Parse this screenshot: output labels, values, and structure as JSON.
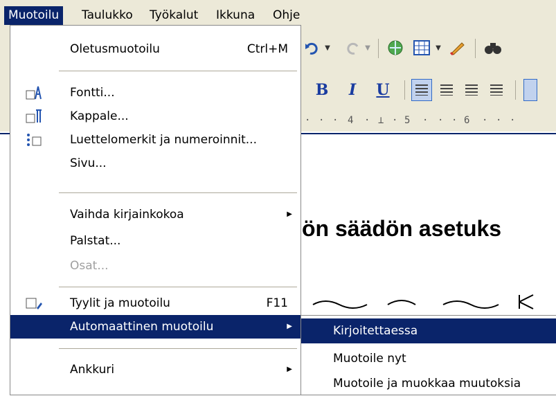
{
  "menubar": {
    "items": [
      {
        "label": "Muotoilu",
        "active": true
      },
      {
        "label": "Taulukko"
      },
      {
        "label": "Työkalut"
      },
      {
        "label": "Ikkuna"
      },
      {
        "label": "Ohje"
      }
    ]
  },
  "toolbar": {
    "bold": "B",
    "italic": "I",
    "underline": "U"
  },
  "ruler": {
    "marks": [
      "4",
      "5",
      "6"
    ]
  },
  "document": {
    "heading": "ön säädön asetuks"
  },
  "format_menu": {
    "items": [
      {
        "label": "Oletusmuotoilu",
        "shortcut": "Ctrl+M"
      },
      {
        "label": "Fontti..."
      },
      {
        "label": "Kappale..."
      },
      {
        "label": "Luettelomerkit ja numeroinnit..."
      },
      {
        "label": "Sivu..."
      },
      {
        "label": "Vaihda kirjainkokoa",
        "submenu": true
      },
      {
        "label": "Palstat..."
      },
      {
        "label": "Osat...",
        "disabled": true
      },
      {
        "label": "Tyylit ja muotoilu",
        "shortcut": "F11"
      },
      {
        "label": "Automaattinen muotoilu",
        "submenu": true,
        "highlighted": true
      },
      {
        "label": "Ankkuri",
        "submenu": true
      }
    ]
  },
  "autoformat_submenu": {
    "items": [
      {
        "label": "Kirjoitettaessa",
        "highlighted": true
      },
      {
        "label": "Muotoile nyt"
      },
      {
        "label": "Muotoile ja muokkaa muutoksia"
      }
    ]
  },
  "colors": {
    "highlight": "#0a246a",
    "menubar_bg": "#ece9d8",
    "disabled_text": "#a0a0a0"
  }
}
